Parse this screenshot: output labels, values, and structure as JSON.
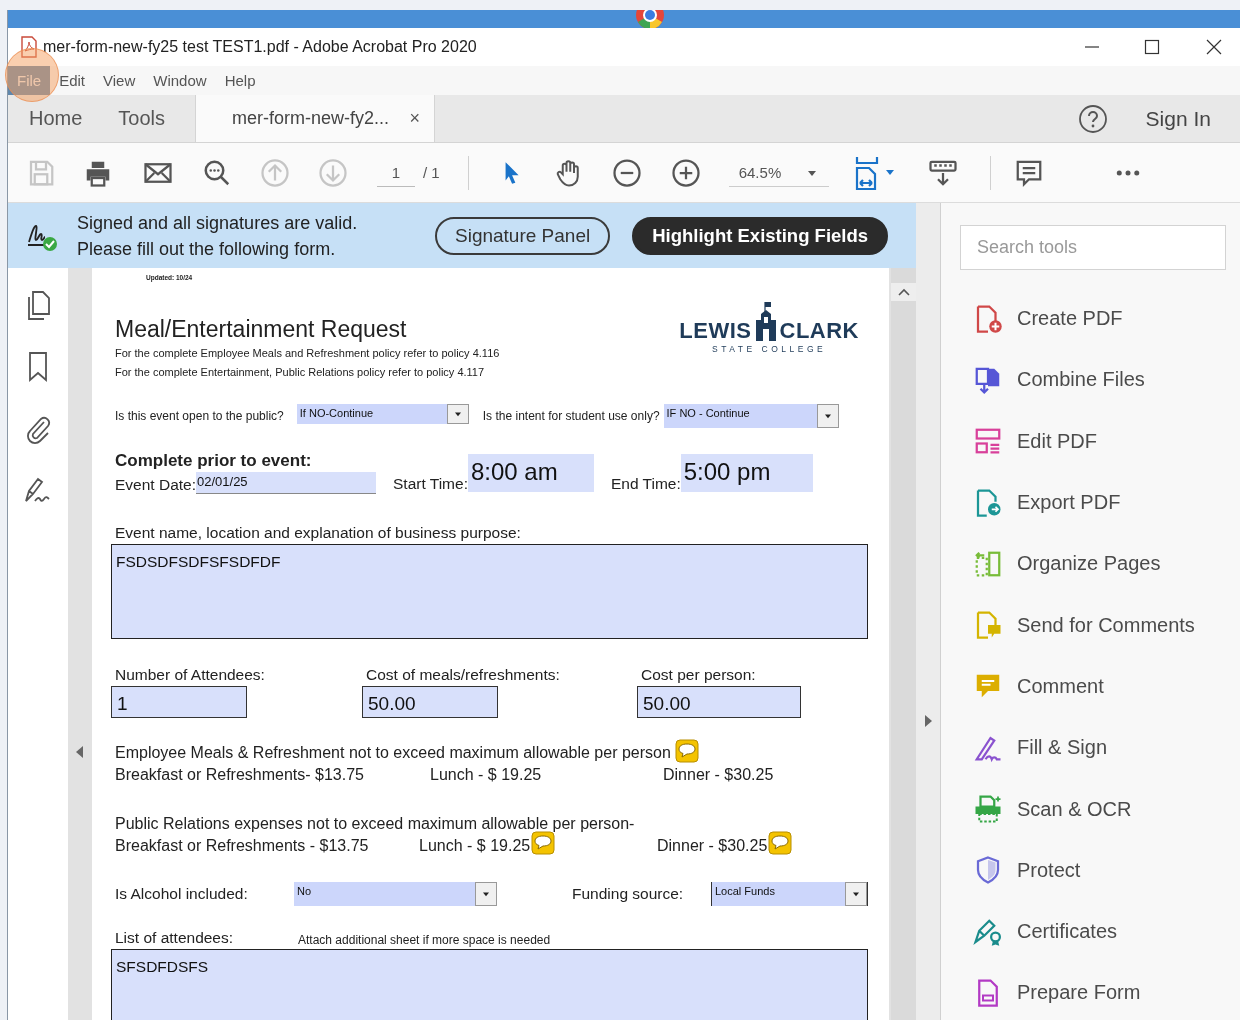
{
  "window": {
    "title": "mer-form-new-fy25 test TEST1.pdf - Adobe Acrobat Pro 2020"
  },
  "menu": [
    {
      "label": "File",
      "selected": true
    },
    {
      "label": "Edit",
      "selected": false
    },
    {
      "label": "View",
      "selected": false
    },
    {
      "label": "Window",
      "selected": false
    },
    {
      "label": "Help",
      "selected": false
    }
  ],
  "tabs": [
    {
      "label": "Home",
      "selected": false
    },
    {
      "label": "Tools",
      "selected": false
    },
    {
      "label": "mer-form-new-fy2...",
      "selected": true,
      "close": "×"
    }
  ],
  "account": {
    "sign_in": "Sign In"
  },
  "toolbar": [
    {
      "kind": "save",
      "disabled": true
    },
    {
      "kind": "print",
      "disabled": false
    },
    {
      "kind": "mail",
      "disabled": false
    },
    {
      "kind": "find",
      "disabled": false
    },
    {
      "kind": "prev_page",
      "disabled": true
    },
    {
      "kind": "next_page",
      "disabled": true
    },
    {
      "kind": "page",
      "value": "1",
      "total": "/ 1"
    },
    {
      "kind": "separator"
    },
    {
      "kind": "select",
      "disabled": false
    },
    {
      "kind": "hand",
      "disabled": false
    },
    {
      "kind": "zoom_out",
      "disabled": false
    },
    {
      "kind": "zoom_in",
      "disabled": false
    },
    {
      "kind": "zoom",
      "value": "64.5%"
    },
    {
      "kind": "fit_page",
      "disabled": false
    },
    {
      "kind": "scroll_mode",
      "disabled": false
    },
    {
      "kind": "separator"
    },
    {
      "kind": "comment",
      "disabled": false
    },
    {
      "kind": "more",
      "disabled": false
    }
  ],
  "signature_bar": {
    "lines": [
      "Signed and all signatures are valid.",
      "Please fill out the following form."
    ],
    "buttons": [
      {
        "label": "Signature Panel",
        "kind": "outline"
      },
      {
        "label": "Highlight Existing Fields",
        "kind": "filled"
      }
    ]
  },
  "form": {
    "updated": "Updated: 10/24",
    "title": "Meal/Entertainment Request",
    "logo": {
      "left": "LEWIS",
      "right": "CLARK",
      "sub": "STATE COLLEGE"
    },
    "policy_lines": [
      "For the complete Employee Meals and Refreshment policy refer to policy 4.116",
      "For the complete Entertainment, Public Relations policy refer to policy 4.117"
    ],
    "questions": [
      {
        "label": "Is this event open to the public?",
        "value": "If NO-Continue"
      },
      {
        "label": "Is the intent for student use only?",
        "value": "IF NO - Continue"
      }
    ],
    "section_heading": "Complete prior to event:",
    "event_date": {
      "label": "Event Date:",
      "value": "02/01/25"
    },
    "start_time": {
      "label": "Start Time:",
      "value": "8:00 am"
    },
    "end_time": {
      "label": "End Time:",
      "value": "5:00 pm"
    },
    "purpose": {
      "label": "Event name, location and explanation of business purpose:",
      "value": "FSDSDFSDFSFSDFDF"
    },
    "costs": [
      {
        "label": "Number of Attendees:",
        "value": "1"
      },
      {
        "label": "Cost of meals/refreshments:",
        "value": "50.00"
      },
      {
        "label": "Cost per person:",
        "value": "50.00"
      }
    ],
    "limits": [
      {
        "heading": "Employee Meals & Refreshment not to exceed maximum allowable per person",
        "heading_comment": true,
        "items": [
          {
            "text": "Breakfast or Refreshments- $13.75",
            "comment": false
          },
          {
            "text": "Lunch - $ 19.25",
            "comment": false
          },
          {
            "text": "Dinner - $30.25",
            "comment": false
          }
        ]
      },
      {
        "heading": "Public Relations expenses not to exceed maximum allowable per person-",
        "heading_comment": false,
        "items": [
          {
            "text": "Breakfast or Refreshments - $13.75",
            "comment": false
          },
          {
            "text": "Lunch - $ 19.25",
            "comment": true
          },
          {
            "text": "Dinner - $30.25",
            "comment": true
          }
        ]
      }
    ],
    "alcohol": {
      "label": "Is Alcohol included:",
      "value": "No"
    },
    "funding": {
      "label": "Funding source:",
      "value": "Local Funds"
    },
    "attendees": {
      "label": "List of attendees:",
      "note": "Attach additional sheet if more space is needed",
      "value": "SFSDFDSFS"
    }
  },
  "tools_panel": {
    "search_placeholder": "Search tools",
    "tools": [
      {
        "label": "Create PDF",
        "kind": "create"
      },
      {
        "label": "Combine Files",
        "kind": "combine"
      },
      {
        "label": "Edit PDF",
        "kind": "edit"
      },
      {
        "label": "Export PDF",
        "kind": "export"
      },
      {
        "label": "Organize Pages",
        "kind": "organize"
      },
      {
        "label": "Send for Comments",
        "kind": "send"
      },
      {
        "label": "Comment",
        "kind": "comment"
      },
      {
        "label": "Fill & Sign",
        "kind": "fill_sign"
      },
      {
        "label": "Scan & OCR",
        "kind": "scan"
      },
      {
        "label": "Protect",
        "kind": "protect"
      },
      {
        "label": "Certificates",
        "kind": "certificates"
      },
      {
        "label": "Prepare Form",
        "kind": "prepare"
      }
    ]
  }
}
